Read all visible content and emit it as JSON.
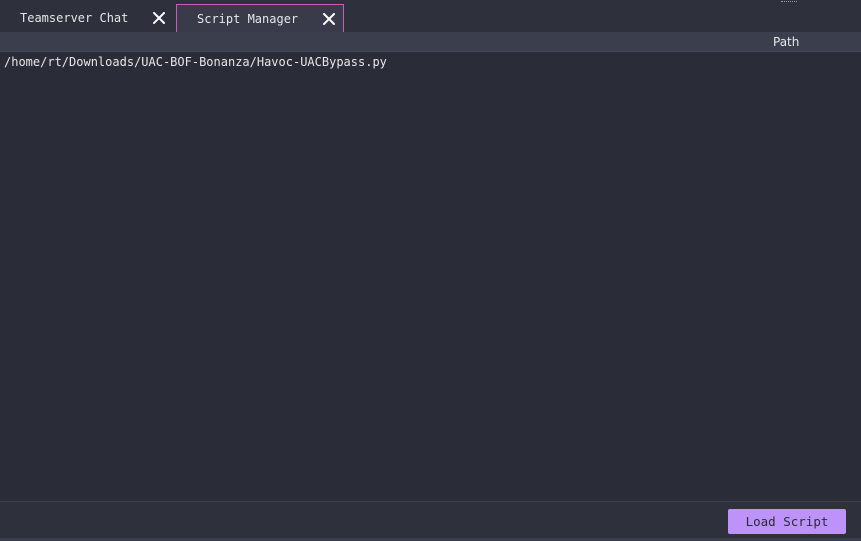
{
  "tabs": [
    {
      "label": "Teamserver Chat",
      "active": false,
      "close_icon": "close-icon"
    },
    {
      "label": "Script Manager",
      "active": true,
      "close_icon": "close-icon"
    }
  ],
  "table": {
    "columns": [
      "Path"
    ],
    "rows": [
      {
        "path": "/home/rt/Downloads/UAC-BOF-Bonanza/Havoc-UACBypass.py"
      }
    ]
  },
  "actions": {
    "load_script_label": "Load Script"
  },
  "colors": {
    "background": "#2a2c38",
    "active_tab_border": "#c65fb7",
    "button_accent": "#bd93f9"
  }
}
